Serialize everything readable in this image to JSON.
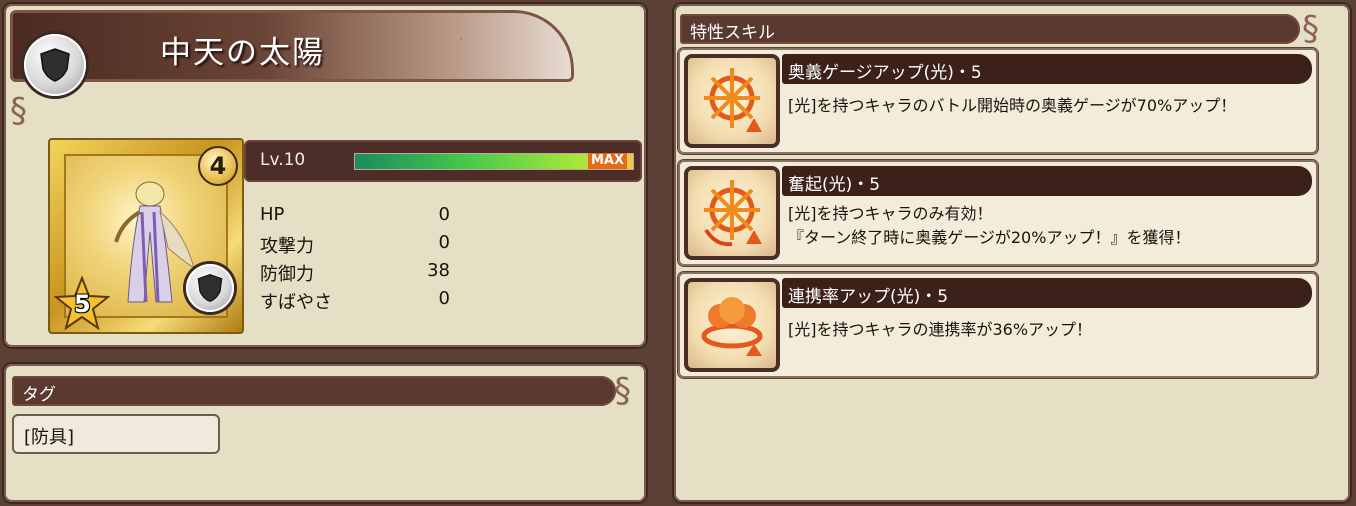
{
  "unit": {
    "name": "中天の太陽",
    "rank": "4",
    "stars": "5",
    "level_label": "Lv.10",
    "level_progress": 1.0,
    "max_label": "MAX",
    "stats": [
      {
        "label": "HP",
        "value": "0"
      },
      {
        "label": "攻撃力",
        "value": "0"
      },
      {
        "label": "防御力",
        "value": "38"
      },
      {
        "label": "すばやさ",
        "value": "0"
      }
    ]
  },
  "tags": {
    "header": "タグ",
    "items": [
      "[防具]"
    ]
  },
  "skills": {
    "header": "特性スキル",
    "items": [
      {
        "name": "奥義ゲージアップ(光)・5",
        "desc": "[光]を持つキャラのバトル開始時の奥義ゲージが70%アップ！",
        "desc2": "",
        "icon": "sunburst-arrow-icon"
      },
      {
        "name": "奮起(光)・5",
        "desc": "[光]を持つキャラのみ有効！",
        "desc2": "『ターン終了時に奥義ゲージが20%アップ！』を獲得！",
        "icon": "sunburst-cycle-icon"
      },
      {
        "name": "連携率アップ(光)・5",
        "desc": "[光]を持つキャラの連携率が36%アップ！",
        "desc2": "",
        "icon": "chain-orbs-icon"
      }
    ]
  },
  "colors": {
    "background": "#5c4035",
    "panel": "#e5dfc6",
    "header": "#5a3a30",
    "skill_bar": "#3c211b",
    "accent_orange": "#e46b1a"
  }
}
